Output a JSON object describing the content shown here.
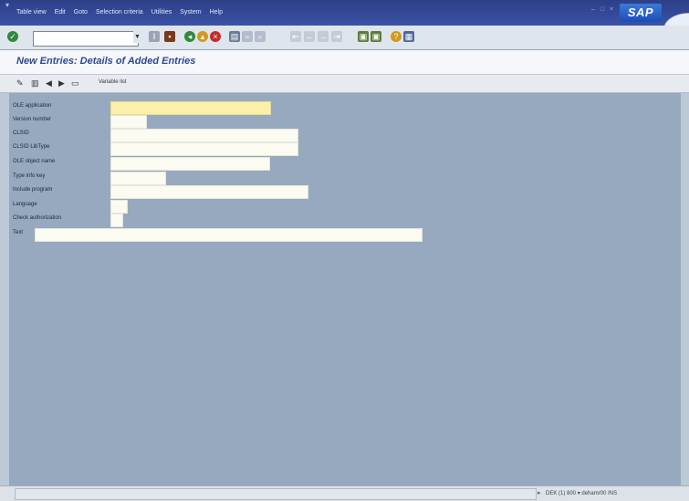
{
  "menubar": {
    "menus": [
      "Table view",
      "Edit",
      "Goto",
      "Selection criteria",
      "Utilities",
      "System",
      "Help"
    ],
    "logo": "SAP"
  },
  "toolbar": {
    "command_value": ""
  },
  "title": "New Entries: Details of Added Entries",
  "app_toolbar": {
    "variable_list_label": "Variable list"
  },
  "form": {
    "fields": [
      {
        "label": "OLE application",
        "value": "",
        "required": true
      },
      {
        "label": "Version number",
        "value": "",
        "required": false
      },
      {
        "label": "CLSID",
        "value": "",
        "required": false
      },
      {
        "label": "CLSID LibType",
        "value": "",
        "required": false
      },
      {
        "label": "OLE object name",
        "value": "",
        "required": false
      },
      {
        "label": "Type info key",
        "value": "",
        "required": false
      },
      {
        "label": "Include program",
        "value": "",
        "required": false
      },
      {
        "label": "Language",
        "value": "",
        "required": false
      },
      {
        "label": "Check authorization",
        "value": "",
        "required": false
      },
      {
        "label": "Text",
        "value": "",
        "required": false
      }
    ]
  },
  "statusbar": {
    "message": "",
    "system_info": "DEK (1) 800",
    "server": "dehamr00",
    "mode": "INS"
  },
  "colors": {
    "menubar": "#3b53a6",
    "workarea": "#96a9be",
    "required_field": "#fbf0a8",
    "title_text": "#2d4a8c"
  }
}
